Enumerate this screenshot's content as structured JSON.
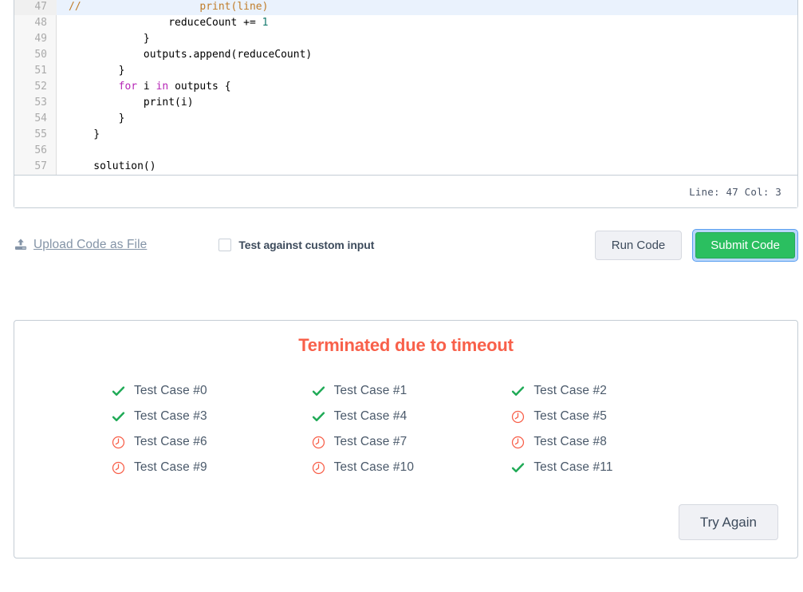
{
  "editor": {
    "first_line_number": 47,
    "lines": [
      {
        "num": 47,
        "active": true,
        "tokens": [
          {
            "t": "// ",
            "c": "comment"
          },
          {
            "t": "                  print(line)",
            "c": "comment"
          }
        ]
      },
      {
        "num": 48,
        "active": false,
        "tokens": [
          {
            "t": "                reduceCount += ",
            "c": "plain"
          },
          {
            "t": "1",
            "c": "number"
          }
        ]
      },
      {
        "num": 49,
        "active": false,
        "tokens": [
          {
            "t": "            }",
            "c": "plain"
          }
        ]
      },
      {
        "num": 50,
        "active": false,
        "tokens": [
          {
            "t": "            outputs.append(reduceCount)",
            "c": "plain"
          }
        ]
      },
      {
        "num": 51,
        "active": false,
        "tokens": [
          {
            "t": "        }",
            "c": "plain"
          }
        ]
      },
      {
        "num": 52,
        "active": false,
        "tokens": [
          {
            "t": "        ",
            "c": "plain"
          },
          {
            "t": "for",
            "c": "keyword"
          },
          {
            "t": " i ",
            "c": "plain"
          },
          {
            "t": "in",
            "c": "keyword"
          },
          {
            "t": " outputs {",
            "c": "plain"
          }
        ]
      },
      {
        "num": 53,
        "active": false,
        "tokens": [
          {
            "t": "            print(i)",
            "c": "plain"
          }
        ]
      },
      {
        "num": 54,
        "active": false,
        "tokens": [
          {
            "t": "        }",
            "c": "plain"
          }
        ]
      },
      {
        "num": 55,
        "active": false,
        "tokens": [
          {
            "t": "    }",
            "c": "plain"
          }
        ]
      },
      {
        "num": 56,
        "active": false,
        "tokens": [
          {
            "t": "",
            "c": "plain"
          }
        ]
      },
      {
        "num": 57,
        "active": false,
        "tokens": [
          {
            "t": "    solution()",
            "c": "plain"
          }
        ]
      }
    ],
    "status": "Line: 47 Col: 3"
  },
  "toolbar": {
    "upload_label": "Upload Code as File",
    "upload_icon": "upload-icon",
    "custom_input_label": "Test against custom input",
    "custom_input_checked": false,
    "run_label": "Run Code",
    "submit_label": "Submit Code",
    "submit_focused": true
  },
  "results": {
    "title": "Terminated due to timeout",
    "title_color": "#f8604a",
    "pass_color": "#1faa56",
    "timeout_color": "#f8604a",
    "testcases": [
      {
        "label": "Test Case #0",
        "status": "passed"
      },
      {
        "label": "Test Case #1",
        "status": "passed"
      },
      {
        "label": "Test Case #2",
        "status": "passed"
      },
      {
        "label": "Test Case #3",
        "status": "passed"
      },
      {
        "label": "Test Case #4",
        "status": "passed"
      },
      {
        "label": "Test Case #5",
        "status": "timeout"
      },
      {
        "label": "Test Case #6",
        "status": "timeout"
      },
      {
        "label": "Test Case #7",
        "status": "timeout"
      },
      {
        "label": "Test Case #8",
        "status": "timeout"
      },
      {
        "label": "Test Case #9",
        "status": "timeout"
      },
      {
        "label": "Test Case #10",
        "status": "timeout"
      },
      {
        "label": "Test Case #11",
        "status": "passed"
      }
    ],
    "try_again_label": "Try Again"
  }
}
